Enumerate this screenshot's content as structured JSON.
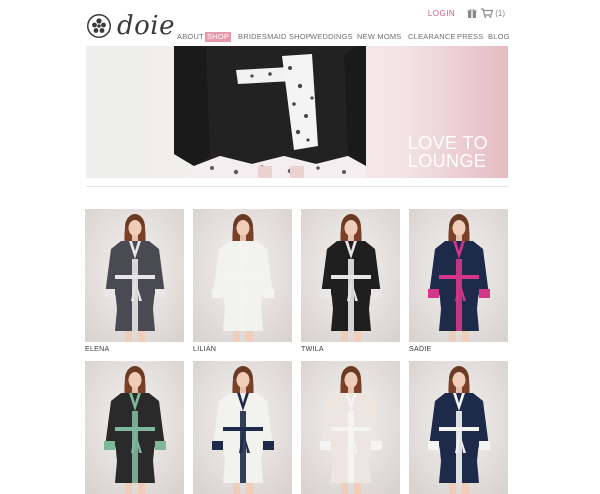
{
  "brand": {
    "name": "doie",
    "logo_icon": "flower-medallion-icon"
  },
  "utility": {
    "login": "LOGIN",
    "gift_icon": "gift-icon",
    "cart_icon": "cart-icon",
    "cart_count": "(1)"
  },
  "nav": {
    "items": [
      {
        "label": "ABOUT",
        "active": false
      },
      {
        "label": "SHOP",
        "active": true
      },
      {
        "label": "BRIDESMAID SHOP",
        "active": false
      },
      {
        "label": "WEDDINGS",
        "active": false
      },
      {
        "label": "NEW MOMS",
        "active": false
      },
      {
        "label": "CLEARANCE",
        "active": false
      },
      {
        "label": "PRESS",
        "active": false
      },
      {
        "label": "BLOG",
        "active": false
      }
    ]
  },
  "hero": {
    "line1": "LOVE TO",
    "line2": "LOUNGE"
  },
  "products": [
    {
      "name": "ELENA",
      "robe_color": "#4a4a52",
      "trim": "floral"
    },
    {
      "name": "LILIAN",
      "robe_color": "#f2f2ef",
      "trim": "white"
    },
    {
      "name": "TWILA",
      "robe_color": "#1f1f1f",
      "trim": "floral"
    },
    {
      "name": "SADIE",
      "robe_color": "#1e2a4a",
      "trim": "pink"
    },
    {
      "name": "",
      "robe_color": "#2a2a2a",
      "trim": "green"
    },
    {
      "name": "",
      "robe_color": "#f2f2ef",
      "trim": "navy"
    },
    {
      "name": "",
      "robe_color": "#ede6e0",
      "trim": "white"
    },
    {
      "name": "",
      "robe_color": "#1e2a4a",
      "trim": "white"
    }
  ],
  "colors": {
    "accent_pink": "#e59aa9",
    "login_pink": "#c75d7c",
    "text_dark": "#3a3a3a",
    "nav_gray": "#6f6f6f"
  }
}
